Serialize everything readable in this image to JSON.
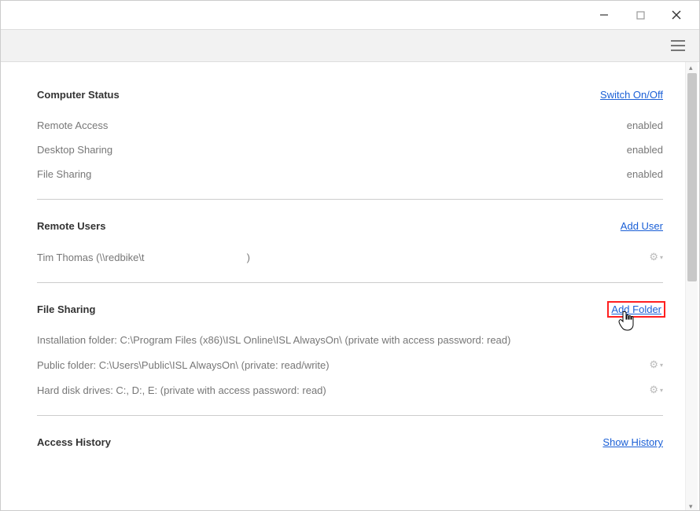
{
  "window": {
    "minimize": "—",
    "maximize": "▢",
    "close": "✕"
  },
  "sections": {
    "computer_status": {
      "title": "Computer Status",
      "action": "Switch On/Off",
      "rows": [
        {
          "label": "Remote Access",
          "value": "enabled"
        },
        {
          "label": "Desktop Sharing",
          "value": "enabled"
        },
        {
          "label": "File Sharing",
          "value": "enabled"
        }
      ]
    },
    "remote_users": {
      "title": "Remote Users",
      "action": "Add User",
      "rows": [
        {
          "label": "Tim Thomas (\\\\redbike\\t                                    )"
        }
      ]
    },
    "file_sharing": {
      "title": "File Sharing",
      "action": "Add Folder",
      "rows": [
        {
          "label": "Installation folder: C:\\Program Files (x86)\\ISL Online\\ISL AlwaysOn\\ (private with access password: read)"
        },
        {
          "label": "Public folder: C:\\Users\\Public\\ISL AlwaysOn\\ (private: read/write)"
        },
        {
          "label": "Hard disk drives: C:, D:, E: (private with access password: read)"
        }
      ]
    },
    "access_history": {
      "title": "Access History",
      "action": "Show History"
    }
  }
}
